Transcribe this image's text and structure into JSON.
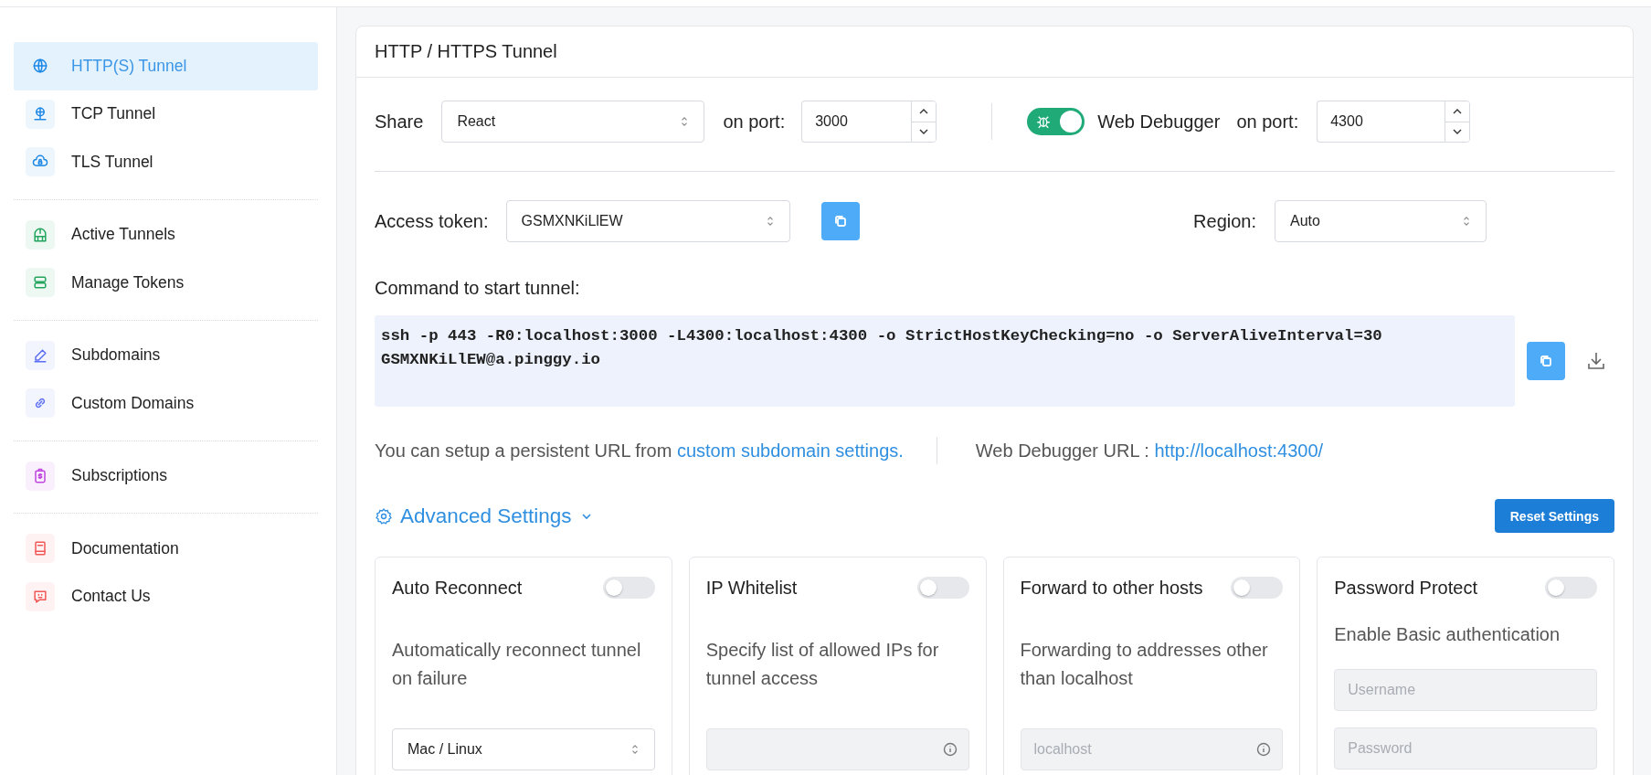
{
  "sidebar": {
    "groups": [
      [
        {
          "label": "HTTP(S) Tunnel",
          "color": "#1e88e5",
          "selected": true
        },
        {
          "label": "TCP Tunnel",
          "color": "#1e88e5",
          "selected": false
        },
        {
          "label": "TLS Tunnel",
          "color": "#1e88e5",
          "selected": false
        }
      ],
      [
        {
          "label": "Active Tunnels",
          "color": "#22a45d",
          "selected": false
        },
        {
          "label": "Manage Tokens",
          "color": "#22a45d",
          "selected": false
        }
      ],
      [
        {
          "label": "Subdomains",
          "color": "#5b6ef5",
          "selected": false
        },
        {
          "label": "Custom Domains",
          "color": "#5b6ef5",
          "selected": false
        }
      ],
      [
        {
          "label": "Subscriptions",
          "color": "#c044e0",
          "selected": false
        }
      ],
      [
        {
          "label": "Documentation",
          "color": "#f25757",
          "selected": false
        },
        {
          "label": "Contact Us",
          "color": "#f25757",
          "selected": false
        }
      ]
    ]
  },
  "panel": {
    "title": "HTTP / HTTPS Tunnel",
    "share": {
      "label": "Share",
      "value": "React",
      "port_label": "on port:",
      "port": "3000"
    },
    "debugger": {
      "on": true,
      "label": "Web Debugger",
      "port_label": "on port:",
      "port": "4300"
    },
    "token": {
      "label": "Access token:",
      "value": "GSMXNKiLlEW"
    },
    "region": {
      "label": "Region:",
      "value": "Auto"
    },
    "command": {
      "label": "Command to start tunnel:",
      "text": "ssh -p 443 -R0:localhost:3000 -L4300:localhost:4300 -o StrictHostKeyChecking=no -o ServerAliveInterval=30 GSMXNKiLlEW@a.pinggy.io"
    },
    "info": {
      "text": "You can setup a persistent URL from ",
      "link": "custom subdomain settings."
    },
    "debugger_url": {
      "label": "Web Debugger URL : ",
      "link": "http://localhost:4300/"
    },
    "advanced": {
      "label": "Advanced Settings",
      "expanded": true
    },
    "reset_button": "Reset Settings",
    "cards": [
      {
        "kind": "select",
        "title": "Auto Reconnect",
        "on": false,
        "description": "Automatically reconnect tunnel on failure",
        "value": "Mac / Linux"
      },
      {
        "kind": "input",
        "title": "IP Whitelist",
        "on": false,
        "description": "Specify list of allowed IPs for tunnel access",
        "field": {
          "disabled": true
        }
      },
      {
        "kind": "input",
        "title": "Forward to other hosts",
        "on": false,
        "description": "Forwarding to addresses other than localhost",
        "field": {
          "placeholder": "localhost",
          "disabled": true
        }
      },
      {
        "kind": "credentials",
        "title": "Password Protect",
        "on": false,
        "description": "Enable Basic authentication",
        "fields": [
          {
            "placeholder": "Username",
            "disabled": true
          },
          {
            "placeholder": "Password",
            "disabled": true
          }
        ]
      }
    ]
  }
}
